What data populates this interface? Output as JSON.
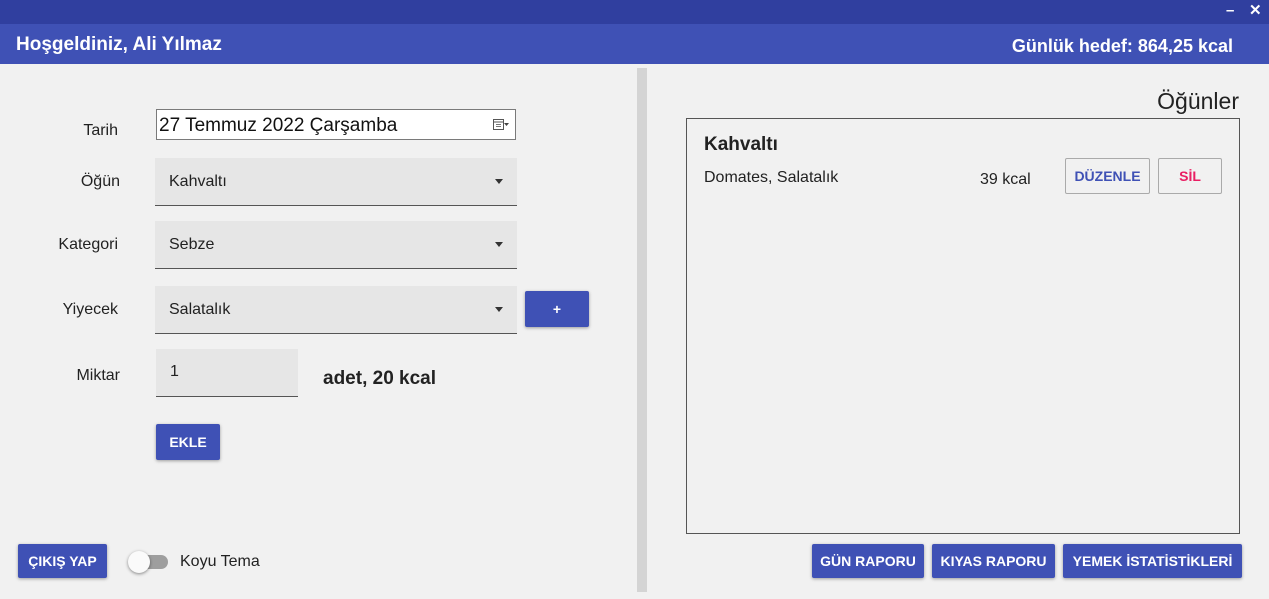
{
  "window": {
    "minimize_glyph": "–",
    "close_glyph": "✕"
  },
  "header": {
    "welcome": "Hoşgeldiniz, Ali Yılmaz",
    "daily_goal": "Günlük hedef: 864,25 kcal"
  },
  "form": {
    "date_label": "Tarih",
    "date_value": "27 Temmuz 2022 Çarşamba",
    "meal_label": "Öğün",
    "meal_value": "Kahvaltı",
    "category_label": "Kategori",
    "category_value": "Sebze",
    "food_label": "Yiyecek",
    "food_value": "Salatalık",
    "add_food_button": "+",
    "amount_label": "Miktar",
    "amount_value": "1",
    "amount_unit": "adet, 20 kcal",
    "add_button": "EKLE"
  },
  "footer_left": {
    "logout_button": "ÇIKIŞ YAP",
    "dark_theme_label": "Koyu Tema",
    "dark_theme_on": false
  },
  "meals": {
    "title": "Öğünler",
    "items": [
      {
        "name": "Kahvaltı",
        "foods": "Domates, Salatalık",
        "kcal": "39 kcal",
        "edit_label": "DÜZENLE",
        "delete_label": "SİL"
      }
    ]
  },
  "reports": {
    "day_report": "GÜN RAPORU",
    "compare_report": "KIYAS RAPORU",
    "food_stats": "YEMEK İSTATİSTİKLERİ"
  },
  "colors": {
    "primary": "#3f51b5",
    "primary_dark": "#303f9f",
    "delete_text": "#e91e63",
    "background": "#f1f1f1"
  }
}
